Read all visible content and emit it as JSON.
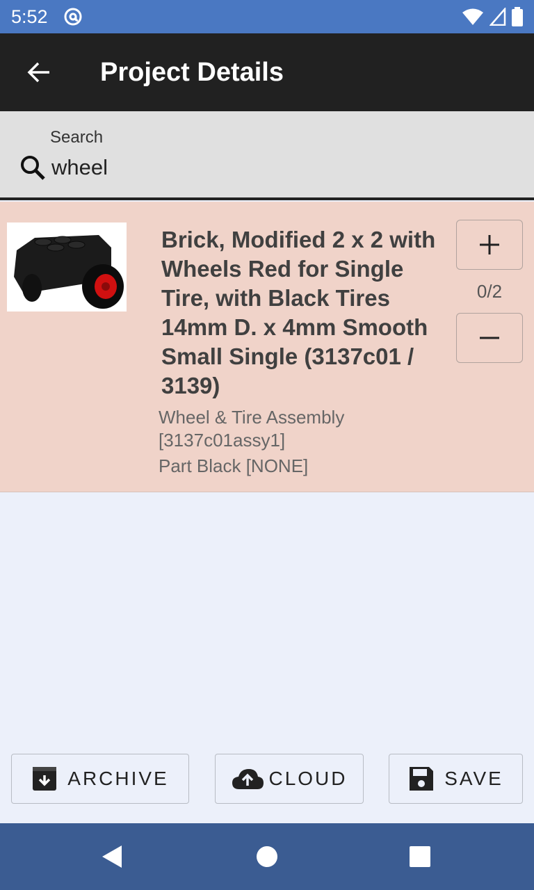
{
  "status_bar": {
    "time": "5:52"
  },
  "app_bar": {
    "title": "Project Details"
  },
  "search": {
    "label": "Search",
    "value": "wheel"
  },
  "result": {
    "title": "Brick, Modified 2 x 2 with Wheels Red for Single Tire, with Black Tires 14mm D. x 4mm Smooth Small Single (3137c01 / 3139)",
    "subtitle": "Wheel & Tire Assembly [3137c01assy1]",
    "color": "Part Black [NONE]",
    "count": "0/2"
  },
  "actions": {
    "archive": "ARCHIVE",
    "cloud": "CLOUD",
    "save": "SAVE"
  },
  "icons": [
    "back-arrow-icon",
    "search-icon",
    "plus-icon",
    "minus-icon",
    "archive-icon",
    "cloud-upload-icon",
    "save-icon",
    "nav-back-icon",
    "nav-home-icon",
    "nav-recents-icon"
  ],
  "colors": {
    "status_bar": "#4a78c2",
    "app_bar": "#212121",
    "result_bg": "#f0d3c9",
    "nav_bar": "#3b5c92",
    "page_bg": "#ecf0fa"
  }
}
